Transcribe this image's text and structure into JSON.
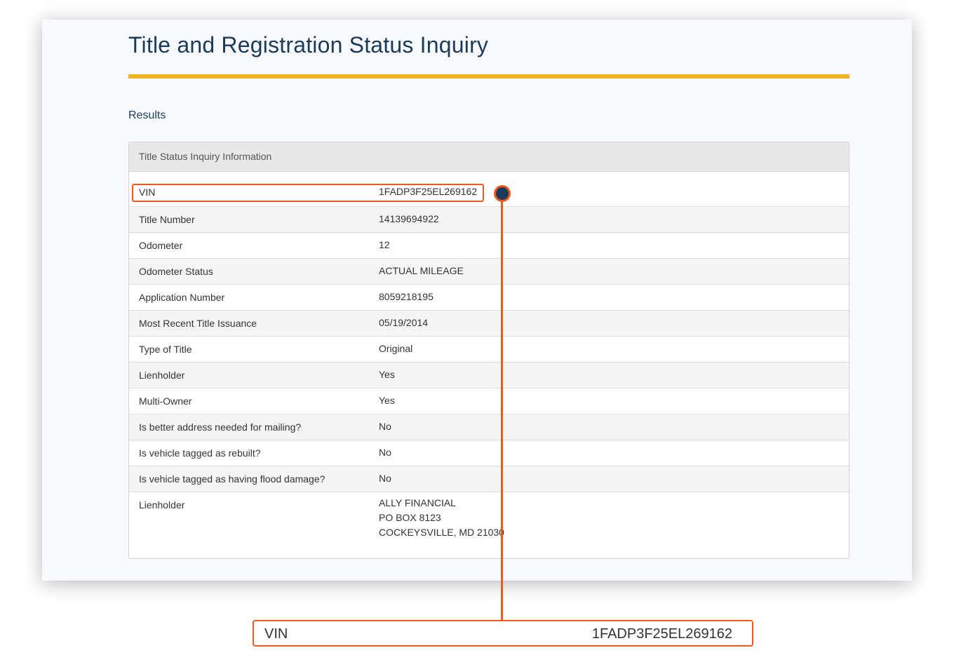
{
  "page": {
    "title": "Title and Registration Status Inquiry",
    "section_label": "Results"
  },
  "panel": {
    "heading": "Title Status Inquiry Information",
    "rows": [
      {
        "label": "VIN",
        "value": "1FADP3F25EL269162"
      },
      {
        "label": "Title Number",
        "value": "14139694922"
      },
      {
        "label": "Odometer",
        "value": "12"
      },
      {
        "label": "Odometer Status",
        "value": "ACTUAL MILEAGE"
      },
      {
        "label": "Application Number",
        "value": "8059218195"
      },
      {
        "label": "Most Recent Title Issuance",
        "value": "05/19/2014"
      },
      {
        "label": "Type of Title",
        "value": "Original"
      },
      {
        "label": "Lienholder",
        "value": "Yes"
      },
      {
        "label": "Multi-Owner",
        "value": "Yes"
      },
      {
        "label": "Is better address needed for mailing?",
        "value": "No"
      },
      {
        "label": "Is vehicle tagged as rebuilt?",
        "value": "No"
      },
      {
        "label": "Is vehicle tagged as having flood damage?",
        "value": "No"
      }
    ],
    "lienholder": {
      "label": "Lienholder",
      "lines": [
        "ALLY FINANCIAL",
        "PO BOX 8123",
        "COCKEYSVILLE, MD 21030"
      ]
    }
  },
  "callout": {
    "label": "VIN",
    "value": "1FADP3F25EL269162"
  },
  "colors": {
    "title": "#1b3b5a",
    "accent_rule": "#f0b323",
    "highlight": "#ee5a1c"
  }
}
